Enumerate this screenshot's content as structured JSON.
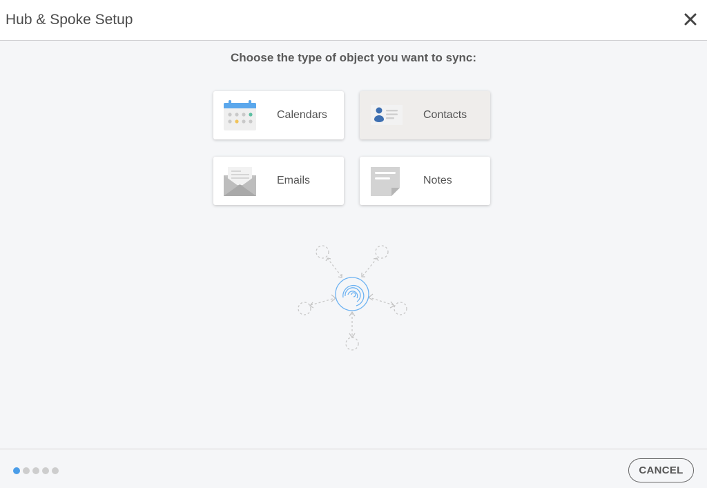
{
  "header": {
    "title": "Hub & Spoke Setup",
    "close_icon": "close-icon"
  },
  "main": {
    "prompt": "Choose the type of object you want to sync:",
    "options": [
      {
        "label": "Calendars",
        "icon": "calendar-icon",
        "selected": false
      },
      {
        "label": "Contacts",
        "icon": "contact-card-icon",
        "selected": true
      },
      {
        "label": "Emails",
        "icon": "envelope-icon",
        "selected": false
      },
      {
        "label": "Notes",
        "icon": "note-icon",
        "selected": false
      }
    ],
    "illustration": "hub-and-spoke-illustration"
  },
  "footer": {
    "steps_total": 5,
    "step_current": 1,
    "cancel_label": "CANCEL"
  },
  "colors": {
    "accent": "#4a9de8",
    "calendar_header": "#5aa7ec",
    "contact_person": "#3d6fb1",
    "dot_inactive": "#cdcdcd",
    "selected_card_bg": "#efedeb"
  }
}
